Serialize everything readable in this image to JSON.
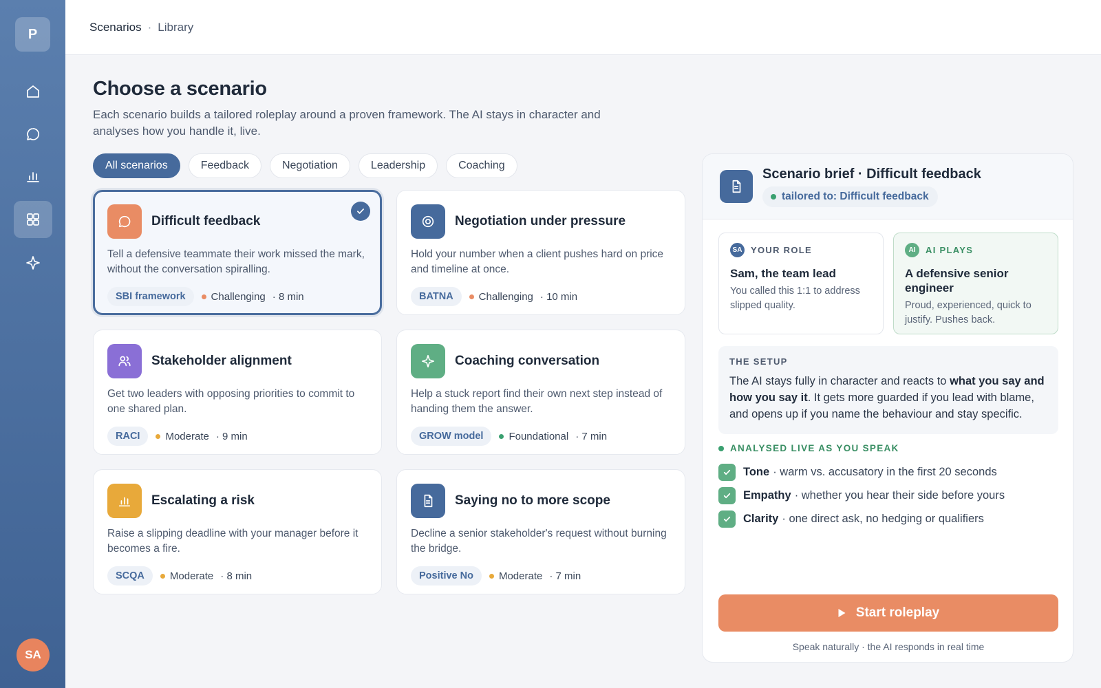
{
  "sidebar": {
    "logo": "P",
    "user_initials": "SA",
    "nav": [
      {
        "name": "home-icon"
      },
      {
        "name": "chat-icon"
      },
      {
        "name": "chart-icon"
      },
      {
        "name": "grid-icon"
      },
      {
        "name": "sparkle-icon"
      }
    ]
  },
  "breadcrumb": {
    "first": "Scenarios",
    "separator": "·",
    "second": "Library"
  },
  "header": {
    "title": "Choose a scenario",
    "description": "Each scenario builds a tailored roleplay around a proven framework. The AI stays in character and analyses how you handle it, live."
  },
  "tabs": [
    {
      "label": "All scenarios",
      "active": true
    },
    {
      "label": "Feedback"
    },
    {
      "label": "Negotiation"
    },
    {
      "label": "Leadership"
    },
    {
      "label": "Coaching"
    }
  ],
  "scenarios": [
    {
      "title": "Difficult feedback",
      "description": "Tell a defensive teammate their work missed the mark, without the conversation spiralling.",
      "framework": "SBI framework",
      "difficulty": "Challenging",
      "duration": "· 8 min",
      "icon": "chat-bubble-icon",
      "icon_color": "#e98c64",
      "dot_color": "#e98c64",
      "selected": true
    },
    {
      "title": "Negotiation under pressure",
      "description": "Hold your number when a client pushes hard on price and timeline at once.",
      "framework": "BATNA",
      "difficulty": "Challenging",
      "duration": "· 10 min",
      "icon": "target-icon",
      "icon_color": "#466a9c",
      "dot_color": "#e98c64"
    },
    {
      "title": "Stakeholder alignment",
      "description": "Get two leaders with opposing priorities to commit to one shared plan.",
      "framework": "RACI",
      "difficulty": "Moderate",
      "duration": "· 9 min",
      "icon": "users-icon",
      "icon_color": "#8a6fd6",
      "dot_color": "#e8a93a"
    },
    {
      "title": "Coaching conversation",
      "description": "Help a stuck report find their own next step instead of handing them the answer.",
      "framework": "GROW model",
      "difficulty": "Foundational",
      "duration": "· 7 min",
      "icon": "sparkle-icon",
      "icon_color": "#5fae84",
      "dot_color": "#3aa070"
    },
    {
      "title": "Escalating a risk",
      "description": "Raise a slipping deadline with your manager before it becomes a fire.",
      "framework": "SCQA",
      "difficulty": "Moderate",
      "duration": "· 8 min",
      "icon": "chart-icon",
      "icon_color": "#e8a93a",
      "dot_color": "#e8a93a"
    },
    {
      "title": "Saying no to more scope",
      "description": "Decline a senior stakeholder's request without burning the bridge.",
      "framework": "Positive No",
      "difficulty": "Moderate",
      "duration": "· 7 min",
      "icon": "document-icon",
      "icon_color": "#466a9c",
      "dot_color": "#e8a93a"
    }
  ],
  "brief": {
    "title": "Scenario brief · Difficult feedback",
    "tag": "tailored to: Difficult feedback",
    "your_role": {
      "initials": "SA",
      "label": "YOUR ROLE",
      "name": "Sam, the team lead",
      "description": "You called this 1:1 to address slipped quality."
    },
    "ai_role": {
      "initials": "AI",
      "label": "AI PLAYS",
      "name": "A defensive senior engineer",
      "description": "Proud, experienced, quick to justify. Pushes back."
    },
    "setup": {
      "label": "THE SETUP",
      "text_1": "The AI stays fully in character and reacts to ",
      "text_bold": "what you say and how you say it",
      "text_2": ". It gets more guarded if you lead with blame, and opens up if you name the behaviour and stay specific."
    },
    "live_label": "ANALYSED LIVE AS YOU SPEAK",
    "metrics": [
      {
        "name": "Tone",
        "detail": "· warm vs. accusatory in the first 20 seconds"
      },
      {
        "name": "Empathy",
        "detail": "· whether you hear their side before yours"
      },
      {
        "name": "Clarity",
        "detail": "· one direct ask, no hedging or qualifiers"
      }
    ],
    "start_label": "Start roleplay",
    "start_hint": "Speak naturally · the AI responds in real time"
  },
  "colors": {
    "accent": "#466a9c",
    "cta": "#e98c64",
    "success": "#3aa070"
  }
}
